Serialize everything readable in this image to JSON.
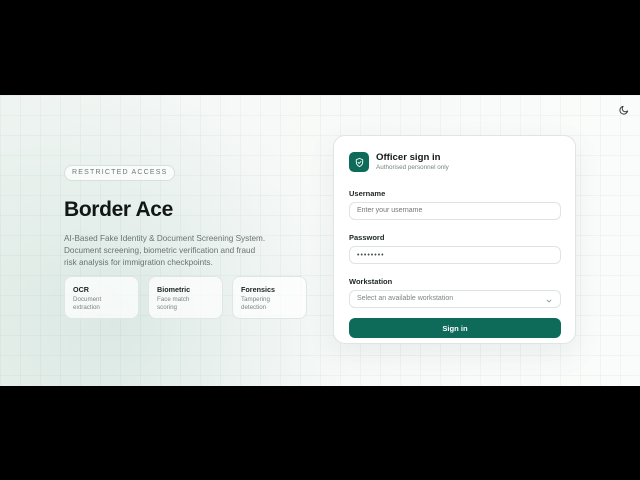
{
  "header": {
    "theme_toggle_icon": "moon-icon"
  },
  "hero": {
    "badge": "RESTRICTED ACCESS",
    "title": "Border Ace",
    "description": "AI-Based Fake Identity & Document Screening System.\nDocument screening, biometric verification and fraud\nrisk analysis for immigration checkpoints.",
    "features": [
      {
        "title": "OCR",
        "subtitle": "Document\nextraction"
      },
      {
        "title": "Biometric",
        "subtitle": "Face match\nscoring"
      },
      {
        "title": "Forensics",
        "subtitle": "Tampering\ndetection"
      }
    ]
  },
  "login": {
    "icon": "shield-icon",
    "title": "Officer sign in",
    "subtitle": "Authorised personnel only",
    "username_label": "Username",
    "username_placeholder": "Enter your username",
    "password_label": "Password",
    "password_value": "••••••••",
    "workstation_label": "Workstation",
    "workstation_placeholder": "Select an available workstation",
    "submit_label": "Sign in"
  },
  "colors": {
    "accent": "#0f6b59",
    "text_dark": "#111716",
    "muted": "#68736f",
    "border": "#dfe6e2",
    "background": "#f7f9f8"
  }
}
